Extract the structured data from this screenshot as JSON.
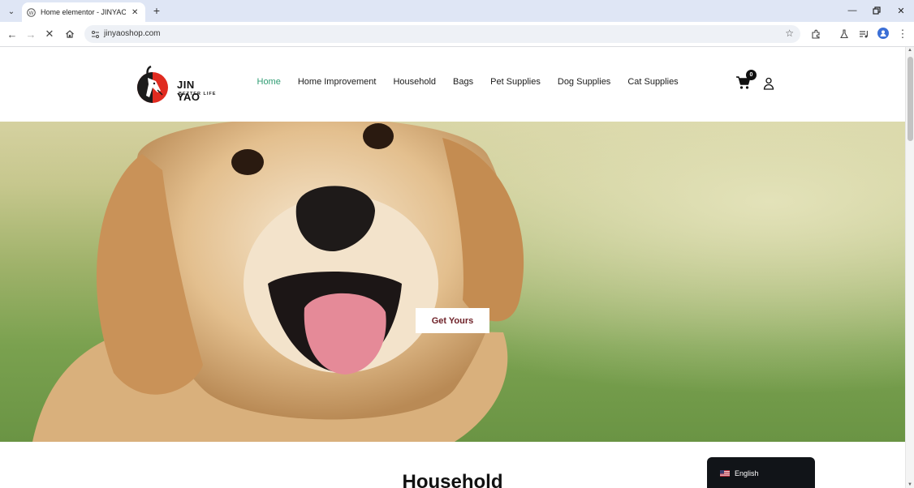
{
  "browser": {
    "tab": {
      "title": "Home elementor - JINYAOSHOP"
    },
    "url": "jinyaoshop.com"
  },
  "site": {
    "logo": {
      "name": "JIN YAO",
      "tagline": "BETTER LIFE"
    },
    "nav": [
      "Home",
      "Home Improvement",
      "Household",
      "Bags",
      "Pet Supplies",
      "Dog Supplies",
      "Cat Supplies"
    ],
    "active_nav": "Home",
    "cart_count": "0",
    "accent_color": "#2f9c73"
  },
  "hero": {
    "button_label": "Get Yours",
    "button_color": "#6e2128"
  },
  "section": {
    "title": "Household"
  },
  "language": {
    "label": "English"
  }
}
